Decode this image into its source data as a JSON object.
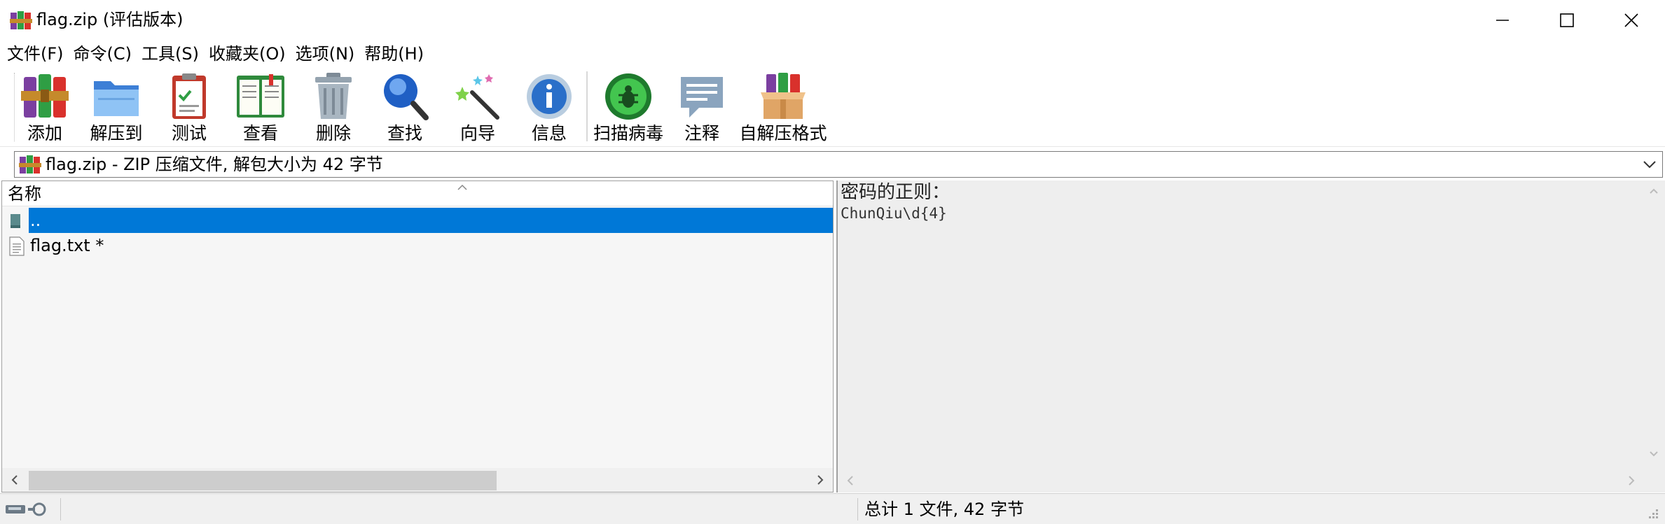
{
  "window": {
    "title": "flag.zip (评估版本)"
  },
  "menu": [
    {
      "label": "文件(F)"
    },
    {
      "label": "命令(C)"
    },
    {
      "label": "工具(S)"
    },
    {
      "label": "收藏夹(O)"
    },
    {
      "label": "选项(N)"
    },
    {
      "label": "帮助(H)"
    }
  ],
  "toolbar": [
    {
      "label": "添加",
      "icon": "add-icon"
    },
    {
      "label": "解压到",
      "icon": "extract-to-icon"
    },
    {
      "label": "测试",
      "icon": "test-icon"
    },
    {
      "label": "查看",
      "icon": "view-icon"
    },
    {
      "label": "删除",
      "icon": "delete-icon"
    },
    {
      "label": "查找",
      "icon": "find-icon"
    },
    {
      "label": "向导",
      "icon": "wizard-icon"
    },
    {
      "label": "信息",
      "icon": "info-icon"
    },
    {
      "label": "扫描病毒",
      "icon": "virus-scan-icon"
    },
    {
      "label": "注释",
      "icon": "comment-icon"
    },
    {
      "label": "自解压格式",
      "icon": "sfx-icon"
    }
  ],
  "address": {
    "text": "flag.zip - ZIP 压缩文件, 解包大小为 42 字节"
  },
  "file_list": {
    "column_name": "名称",
    "rows": [
      {
        "name": "..",
        "selected": true,
        "icon": "parent-folder-icon"
      },
      {
        "name": "flag.txt *",
        "selected": false,
        "icon": "text-file-icon"
      }
    ]
  },
  "comment": {
    "title": "密码的正则：",
    "body": "ChunQiu\\d{4}"
  },
  "status": {
    "summary": "总计 1 文件, 42 字节"
  },
  "colors": {
    "selection": "#0078d7",
    "pane_bg": "#f6f6f6",
    "comment_bg": "#eeeeee"
  }
}
